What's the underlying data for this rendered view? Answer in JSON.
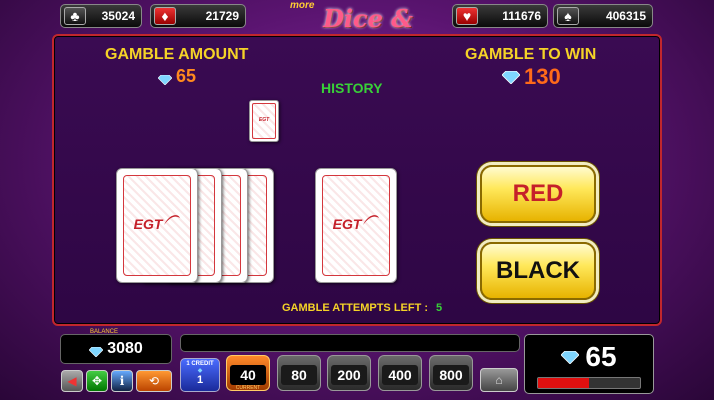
{
  "jackpots": [
    {
      "suit": "clubs",
      "symbol": "♣",
      "value": "35024"
    },
    {
      "suit": "diamonds",
      "symbol": "♦",
      "value": "21729"
    },
    {
      "suit": "hearts",
      "symbol": "♥",
      "value": "111676"
    },
    {
      "suit": "spades",
      "symbol": "♠",
      "value": "406315"
    }
  ],
  "logo": {
    "small": "more",
    "big": "Dice & Roll"
  },
  "gamble": {
    "amount_label": "GAMBLE AMOUNT",
    "amount_value": "65",
    "to_win_label": "GAMBLE TO WIN",
    "to_win_value": "130",
    "history_label": "HISTORY",
    "attempts_label": "GAMBLE ATTEMPTS LEFT :",
    "attempts_value": "5",
    "red_label": "RED",
    "black_label": "BLACK"
  },
  "card_brand": "EGT",
  "bottom": {
    "balance_caption": "BALANCE",
    "balance_value": "3080",
    "credit_label": "1 CREDIT",
    "credit_value": "1",
    "current_bet": "40",
    "current_bet_caption": "CURRENT",
    "bet_options": [
      "80",
      "200",
      "400",
      "800"
    ],
    "win_value": "65",
    "icons": [
      "sound-icon",
      "fullscreen-icon",
      "info-icon",
      "autoplay-icon",
      "home-icon"
    ]
  },
  "colors": {
    "accent_gold": "#f5d327",
    "accent_orange": "#ff8a1e",
    "history_green": "#38d038",
    "red_text": "#c5202a",
    "black_text": "#111111"
  }
}
